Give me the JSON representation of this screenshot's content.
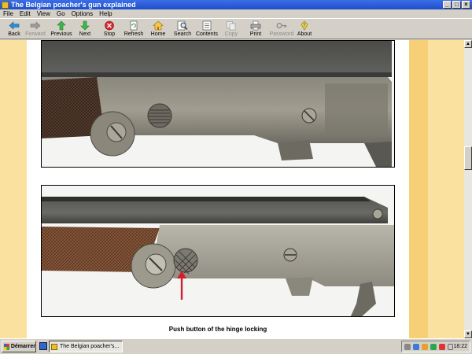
{
  "window": {
    "title": "The Belgian poacher's gun explained",
    "controls": {
      "minimize": "_",
      "maximize": "□",
      "close": "×"
    }
  },
  "menu": [
    "File",
    "Edit",
    "View",
    "Go",
    "Options",
    "Help"
  ],
  "toolbar": [
    {
      "label": "Back",
      "icon": "back-arrow-icon",
      "enabled": true
    },
    {
      "label": "Forward",
      "icon": "forward-arrow-icon",
      "enabled": false
    },
    {
      "label": "Previous",
      "icon": "up-arrow-icon",
      "enabled": true
    },
    {
      "label": "Next",
      "icon": "down-arrow-icon",
      "enabled": true
    },
    {
      "label": "Stop",
      "icon": "stop-icon",
      "enabled": true
    },
    {
      "label": "Refresh",
      "icon": "refresh-icon",
      "enabled": true
    },
    {
      "label": "Home",
      "icon": "home-icon",
      "enabled": true
    },
    {
      "label": "Search",
      "icon": "search-icon",
      "enabled": true
    },
    {
      "label": "Contents",
      "icon": "contents-icon",
      "enabled": true
    },
    {
      "label": "Copy",
      "icon": "copy-icon",
      "enabled": false
    },
    {
      "label": "Print",
      "icon": "print-icon",
      "enabled": true
    },
    {
      "label": "Password",
      "icon": "key-icon",
      "enabled": false
    },
    {
      "label": "About",
      "icon": "about-icon",
      "enabled": true
    }
  ],
  "content": {
    "caption": "Push button of the hinge locking"
  },
  "taskbar": {
    "start_label": "Démarrer",
    "task_label": "The Belgian poacher's...",
    "clock": "18:22"
  },
  "colors": {
    "page_background": "#fae1a0",
    "band": "#f6cf77",
    "arrow": "#d0202a"
  }
}
